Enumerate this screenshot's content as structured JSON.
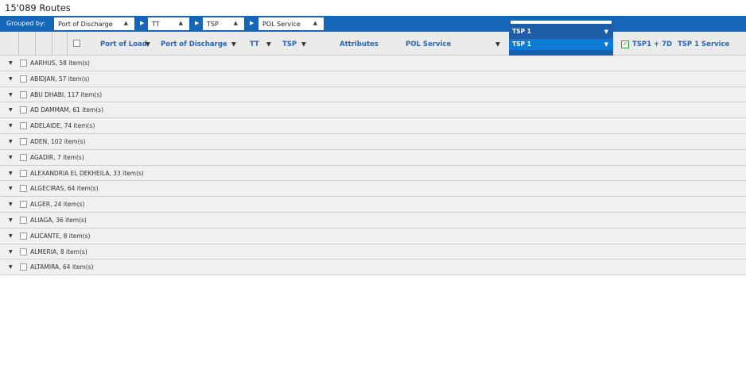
{
  "page_title": "15'089 Routes",
  "group_bar": {
    "label": "Grouped by:",
    "chips": [
      {
        "label": "Port of Discharge",
        "arrow": "▲"
      },
      {
        "label": "TT",
        "arrow": "▲"
      },
      {
        "label": "TSP",
        "arrow": "▲"
      },
      {
        "label": "POL Service",
        "arrow": "▲"
      }
    ],
    "separator": "▶"
  },
  "columns": {
    "port_of_load": "Port of Load",
    "port_of_discharge": "Port of Discharge",
    "tt": "TT",
    "tsp": "TSP",
    "attributes": "Attributes",
    "pol_service": "POL Service",
    "tsp1_7d": "TSP1 + 7D",
    "tsp1_service": "TSP 1 Service",
    "filter_icon": "▼",
    "checkmark": "✓"
  },
  "column_dropdown": {
    "items": [
      {
        "label": "TSP 1",
        "selected": false
      },
      {
        "label": "TSP 1",
        "selected": true
      }
    ]
  },
  "groups": [
    {
      "label": "AARHUS, 58 item(s)"
    },
    {
      "label": "ABIDJAN, 57 item(s)"
    },
    {
      "label": "ABU DHABI, 117 item(s)"
    },
    {
      "label": "AD DAMMAM, 61 item(s)"
    },
    {
      "label": "ADELAIDE, 74 item(s)"
    },
    {
      "label": "ADEN, 102 item(s)"
    },
    {
      "label": "AGADIR, 7 item(s)"
    },
    {
      "label": "ALEXANDRIA EL DEKHEILA, 33 item(s)"
    },
    {
      "label": "ALGECIRAS, 64 item(s)"
    },
    {
      "label": "ALGER, 24 item(s)"
    },
    {
      "label": "ALIAGA, 36 item(s)"
    },
    {
      "label": "ALICANTE, 8 item(s)"
    },
    {
      "label": "ALMERIA, 8 item(s)"
    },
    {
      "label": "ALTAMIRA, 64 item(s)"
    }
  ],
  "row_expand_icon": "▼",
  "colors": {
    "primary_blue": "#1565b8",
    "dropdown_blue": "#1e5da8",
    "dropdown_selected": "#0e7ad6",
    "header_text": "#2a66b0",
    "check_green": "#2e9e3a"
  }
}
